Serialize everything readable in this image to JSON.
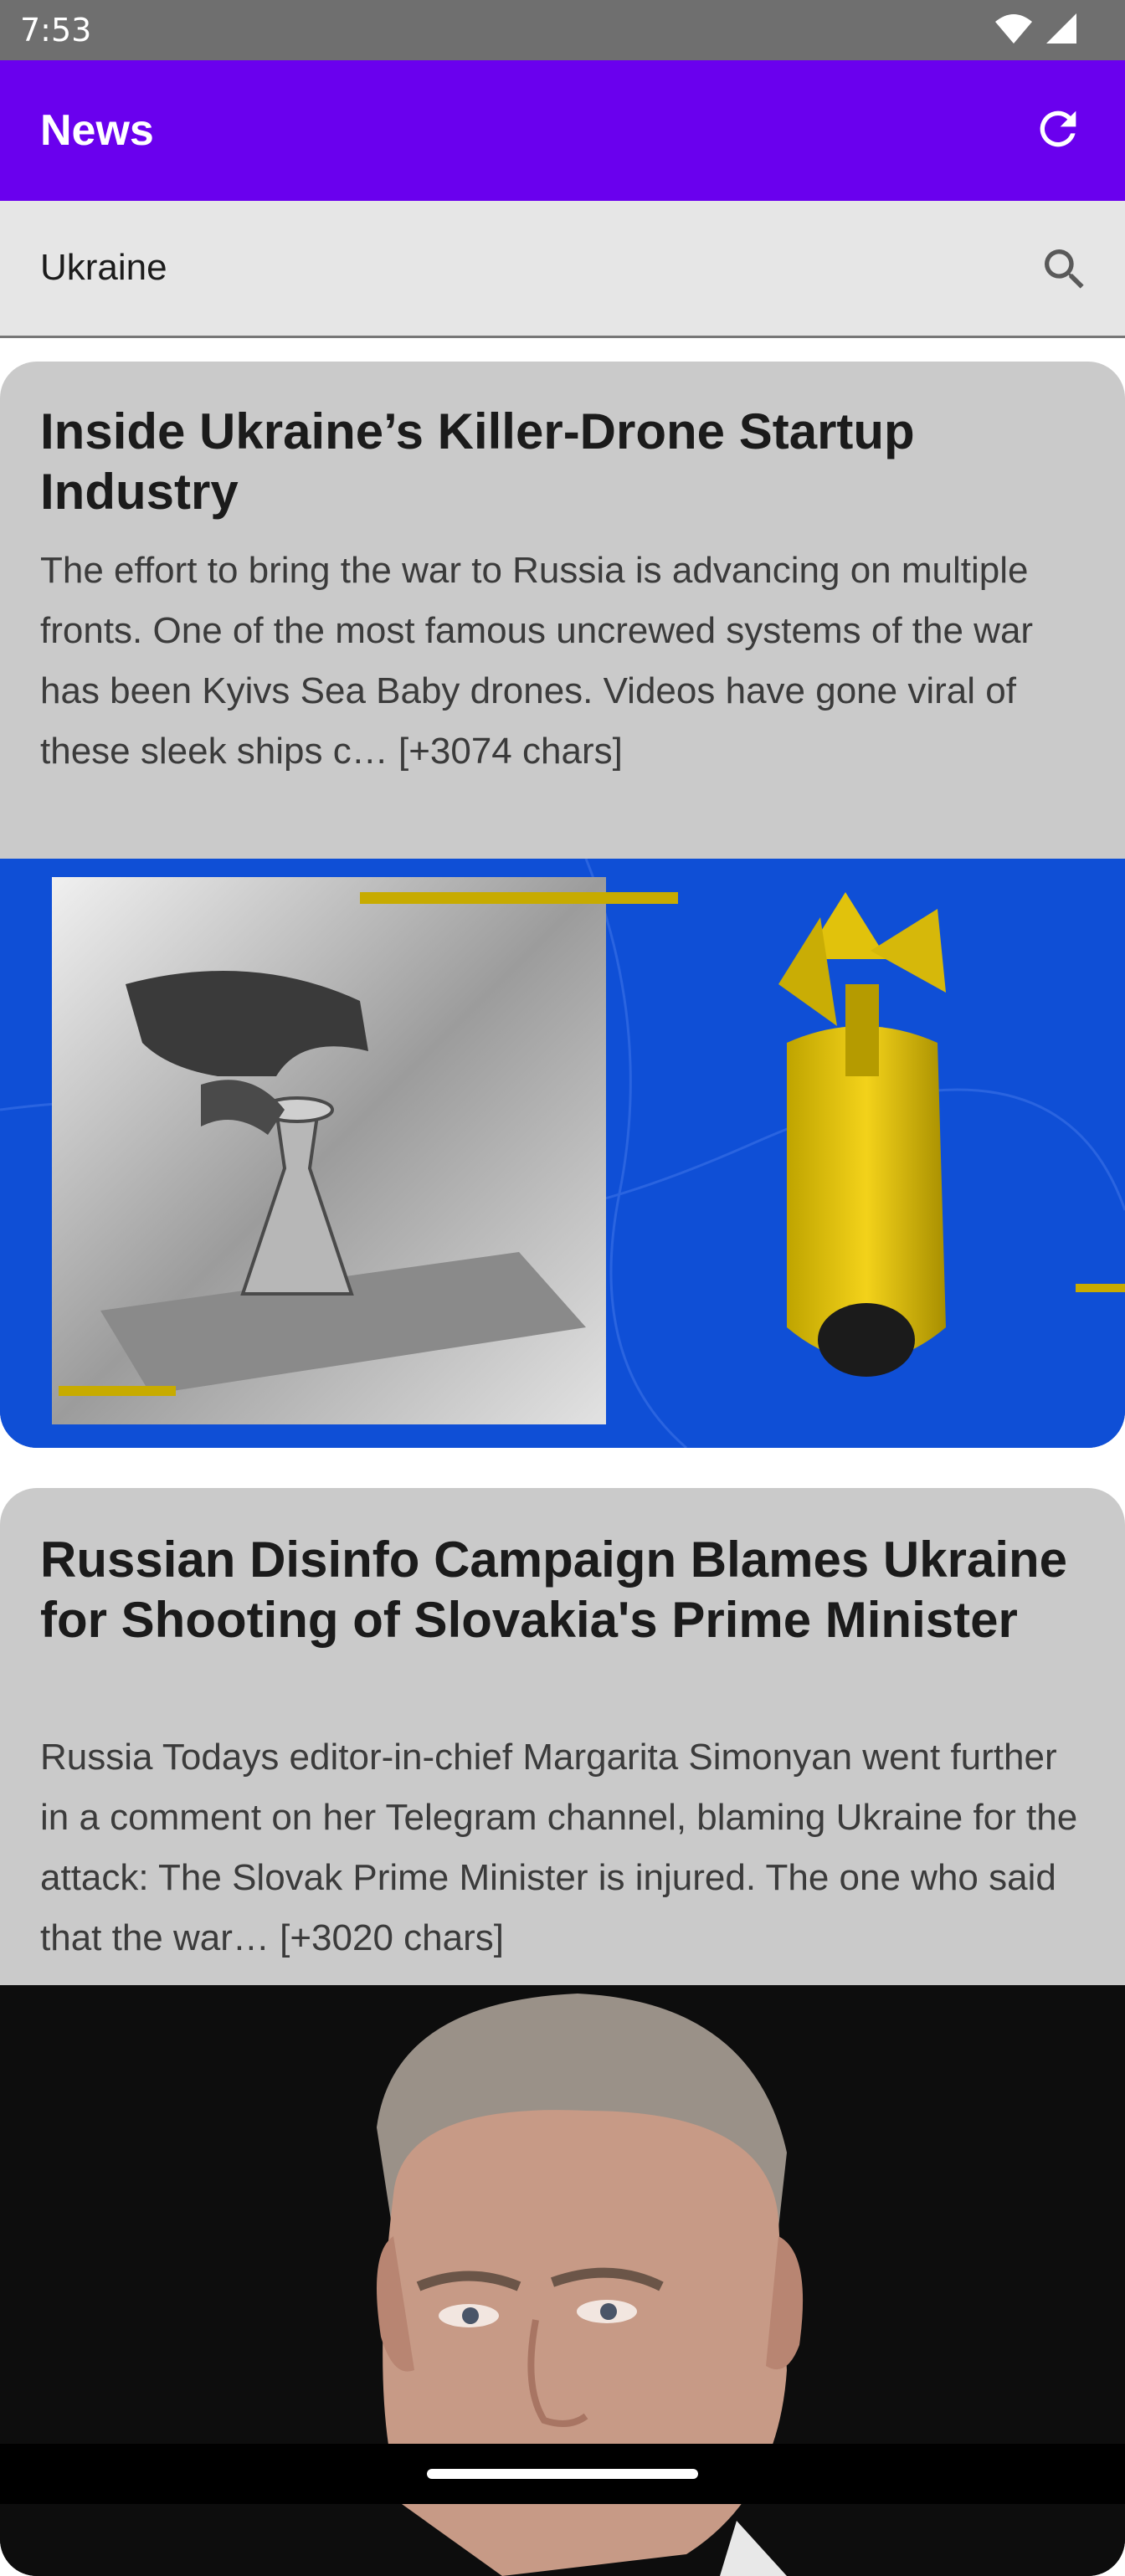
{
  "status_bar": {
    "time": "7:53",
    "icons": [
      "wifi-icon",
      "cellular-signal-icon"
    ]
  },
  "app_bar": {
    "title": "News",
    "refresh_icon": "refresh-icon",
    "background_color": "#6a00ee"
  },
  "search": {
    "value": "Ukraine",
    "icon": "search-icon"
  },
  "articles": [
    {
      "title": "Inside Ukraine’s Killer-Drone Startup Industry",
      "description": "The effort to bring the war to Russia is advancing on multiple fronts. One of the most famous uncrewed systems of the war has been Kyivs Sea Baby drones. Videos have gone viral of these sleek ships c… [+3074 chars]",
      "image": "3d-printed-drone-parts-illustration"
    },
    {
      "title": "Russian Disinfo Campaign Blames Ukraine for Shooting of Slovakia's Prime Minister",
      "description": "Russia Todays editor-in-chief Margarita Simonyan went further in a comment on her Telegram channel, blaming Ukraine for the attack: The Slovak Prime Minister is injured. The one who said that the war… [+3020 chars]",
      "image": "prime-minister-portrait-photo"
    }
  ]
}
